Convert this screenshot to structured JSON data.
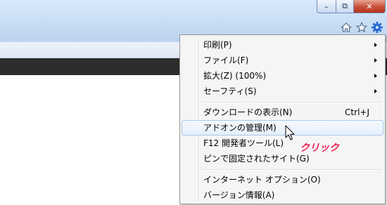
{
  "window": {
    "minimize_label": "–",
    "maximize_label": "⧉",
    "close_label": "✕"
  },
  "toolbar": {
    "icons": [
      "home-icon",
      "favorites-star-icon",
      "tools-gear-icon"
    ]
  },
  "colors": {
    "annotation": "#ee1d50",
    "menu_background": "#f5f5f5",
    "highlight_border": "#a8c8ec",
    "gear": "#2a6ad1"
  },
  "menu": {
    "items": [
      {
        "label": "印刷(P)",
        "submenu": true
      },
      {
        "label": "ファイル(F)",
        "submenu": true
      },
      {
        "label": "拡大(Z) (100%)",
        "submenu": true
      },
      {
        "label": "セーフティ(S)",
        "submenu": true
      },
      {
        "label": "ダウンロードの表示(N)",
        "shortcut": "Ctrl+J"
      },
      {
        "label": "アドオンの管理(M)",
        "highlighted": true
      },
      {
        "label": "F12 開発者ツール(L)"
      },
      {
        "label": "ピンで固定されたサイト(G)"
      },
      {
        "label": "インターネット オプション(O)"
      },
      {
        "label": "バージョン情報(A)"
      }
    ]
  },
  "annotation": {
    "text": "クリック"
  }
}
